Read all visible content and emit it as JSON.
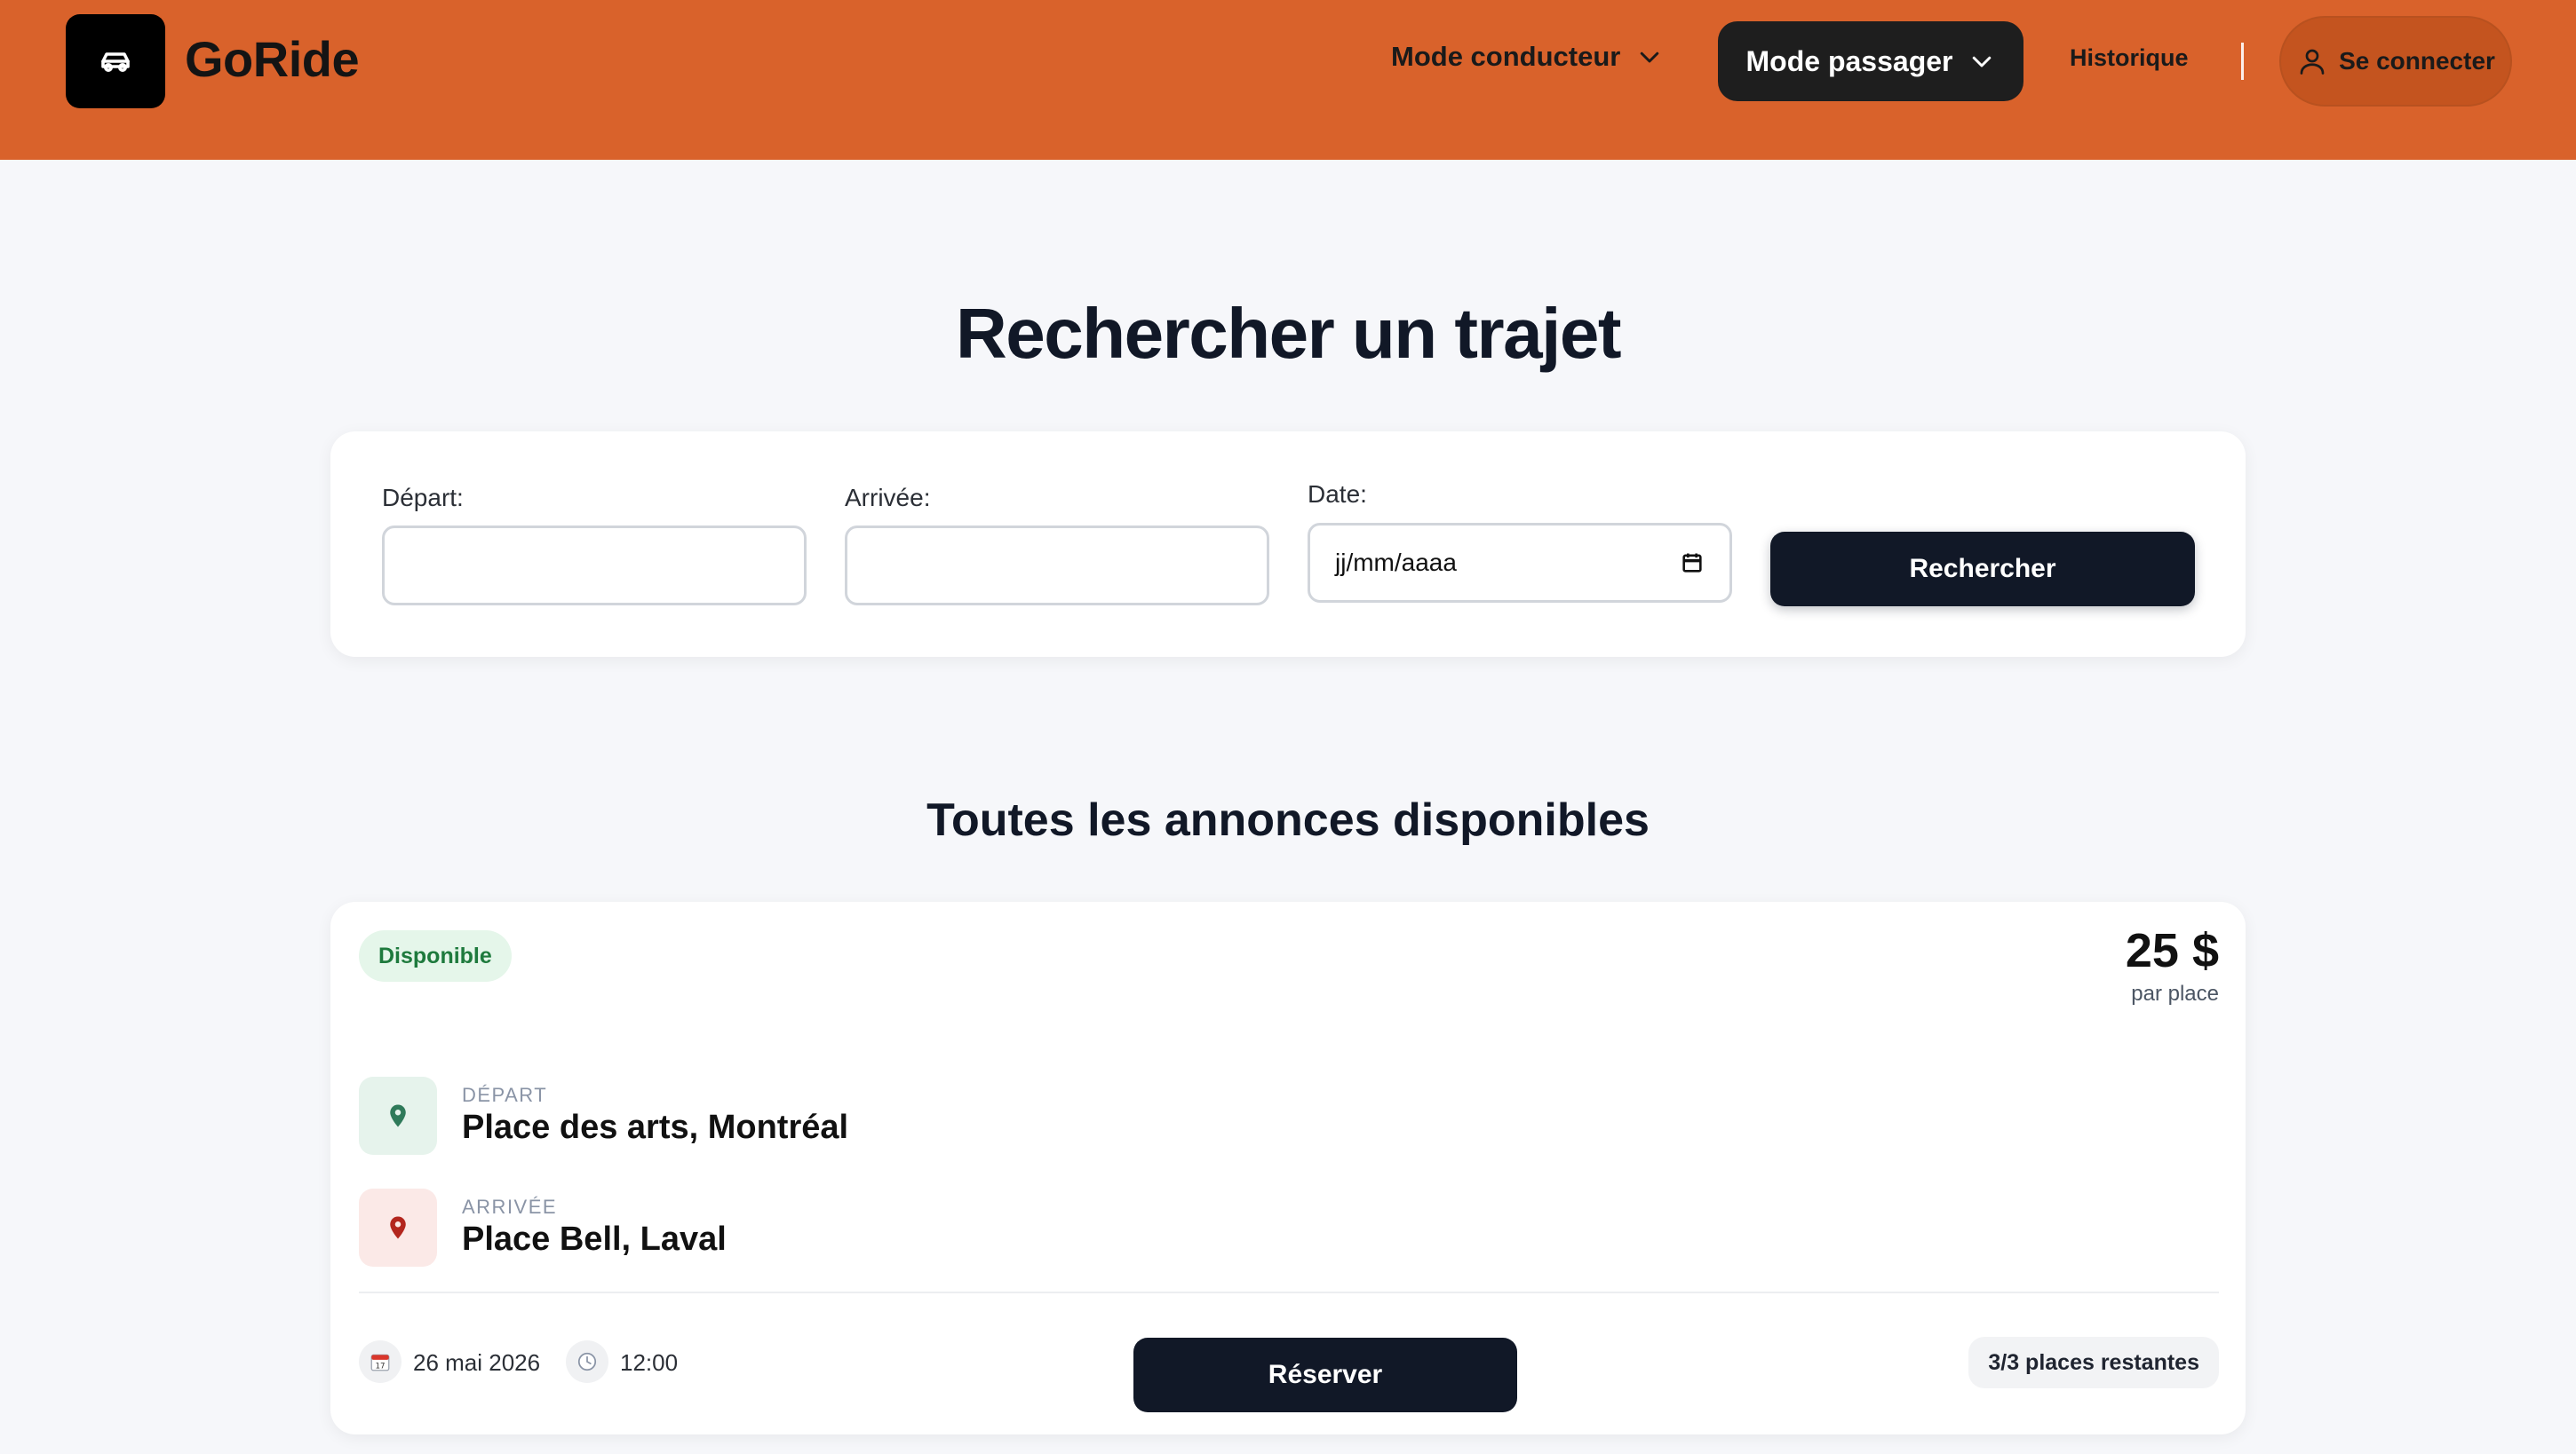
{
  "header": {
    "brand": "GoRide",
    "nav": {
      "driver_mode": "Mode conducteur",
      "passenger_mode": "Mode passager",
      "history": "Historique",
      "login": "Se connecter"
    },
    "colors": {
      "background": "#d9622b",
      "active_pill": "#1e1e1e"
    },
    "icons": {
      "logo": "car-icon",
      "dropdown": "chevron-down-icon",
      "login": "user-icon"
    }
  },
  "search": {
    "title": "Rechercher un trajet",
    "departure_label": "Départ:",
    "departure_value": "",
    "arrival_label": "Arrivée:",
    "arrival_value": "",
    "date_label": "Date:",
    "date_placeholder": "jj/mm/aaaa",
    "button": "Rechercher"
  },
  "listings": {
    "title": "Toutes les annonces disponibles",
    "items": [
      {
        "status": "Disponible",
        "price": "25 $",
        "price_unit": "par place",
        "departure_caption": "DÉPART",
        "departure": "Place des arts, Montréal",
        "arrival_caption": "ARRIVÉE",
        "arrival": "Place Bell, Laval",
        "date": "26 mai 2026",
        "time": "12:00",
        "reserve_label": "Réserver",
        "seats": "3/3 places restantes",
        "colors": {
          "status_bg": "#e5f6ea",
          "status_text": "#1e7a3d",
          "departure_pin": "#2f7a5a",
          "arrival_pin": "#b3261e"
        }
      }
    ]
  }
}
